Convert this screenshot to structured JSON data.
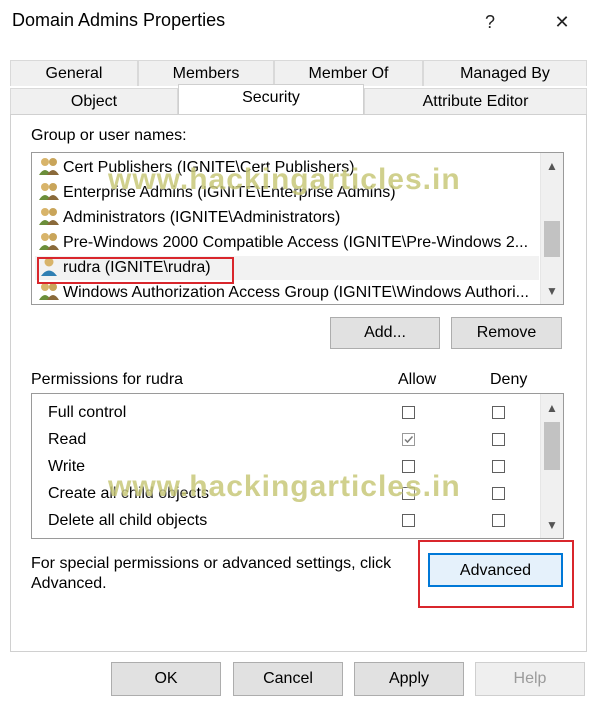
{
  "window": {
    "title": "Domain Admins Properties",
    "help_glyph": "?",
    "close_glyph": "✕"
  },
  "tabs_back": [
    "General",
    "Members",
    "Member Of",
    "Managed By"
  ],
  "tabs_front": [
    "Object",
    "Security",
    "Attribute Editor"
  ],
  "active_tab": "Security",
  "group_section": {
    "label": "Group or user names:",
    "items": [
      {
        "name": "Cert Publishers (IGNITE\\Cert Publishers)",
        "icon": "group-icon"
      },
      {
        "name": "Enterprise Admins (IGNITE\\Enterprise Admins)",
        "icon": "group-icon"
      },
      {
        "name": "Administrators (IGNITE\\Administrators)",
        "icon": "group-icon"
      },
      {
        "name": "Pre-Windows 2000 Compatible Access (IGNITE\\Pre-Windows 2...",
        "icon": "group-icon"
      },
      {
        "name": "rudra (IGNITE\\rudra)",
        "icon": "user-icon",
        "selected": true
      },
      {
        "name": "Windows Authorization Access Group (IGNITE\\Windows Authori...",
        "icon": "group-icon"
      }
    ],
    "add_label": "Add...",
    "remove_label": "Remove"
  },
  "permissions": {
    "label": "Permissions for rudra",
    "allow_header": "Allow",
    "deny_header": "Deny",
    "rows": [
      {
        "name": "Full control",
        "allow": false,
        "deny": false
      },
      {
        "name": "Read",
        "allow": true,
        "deny": false
      },
      {
        "name": "Write",
        "allow": false,
        "deny": false
      },
      {
        "name": "Create all child objects",
        "allow": false,
        "deny": false
      },
      {
        "name": "Delete all child objects",
        "allow": false,
        "deny": false
      }
    ]
  },
  "special": {
    "text_line1": "For special permissions or advanced settings, click",
    "text_line2": "Advanced.",
    "advanced_label": "Advanced"
  },
  "footer": {
    "ok": "OK",
    "cancel": "Cancel",
    "apply": "Apply",
    "help": "Help"
  },
  "watermark": "www.hackingarticles.in",
  "colors": {
    "highlight_red": "#d9262c",
    "focus_blue": "#0078d7"
  }
}
